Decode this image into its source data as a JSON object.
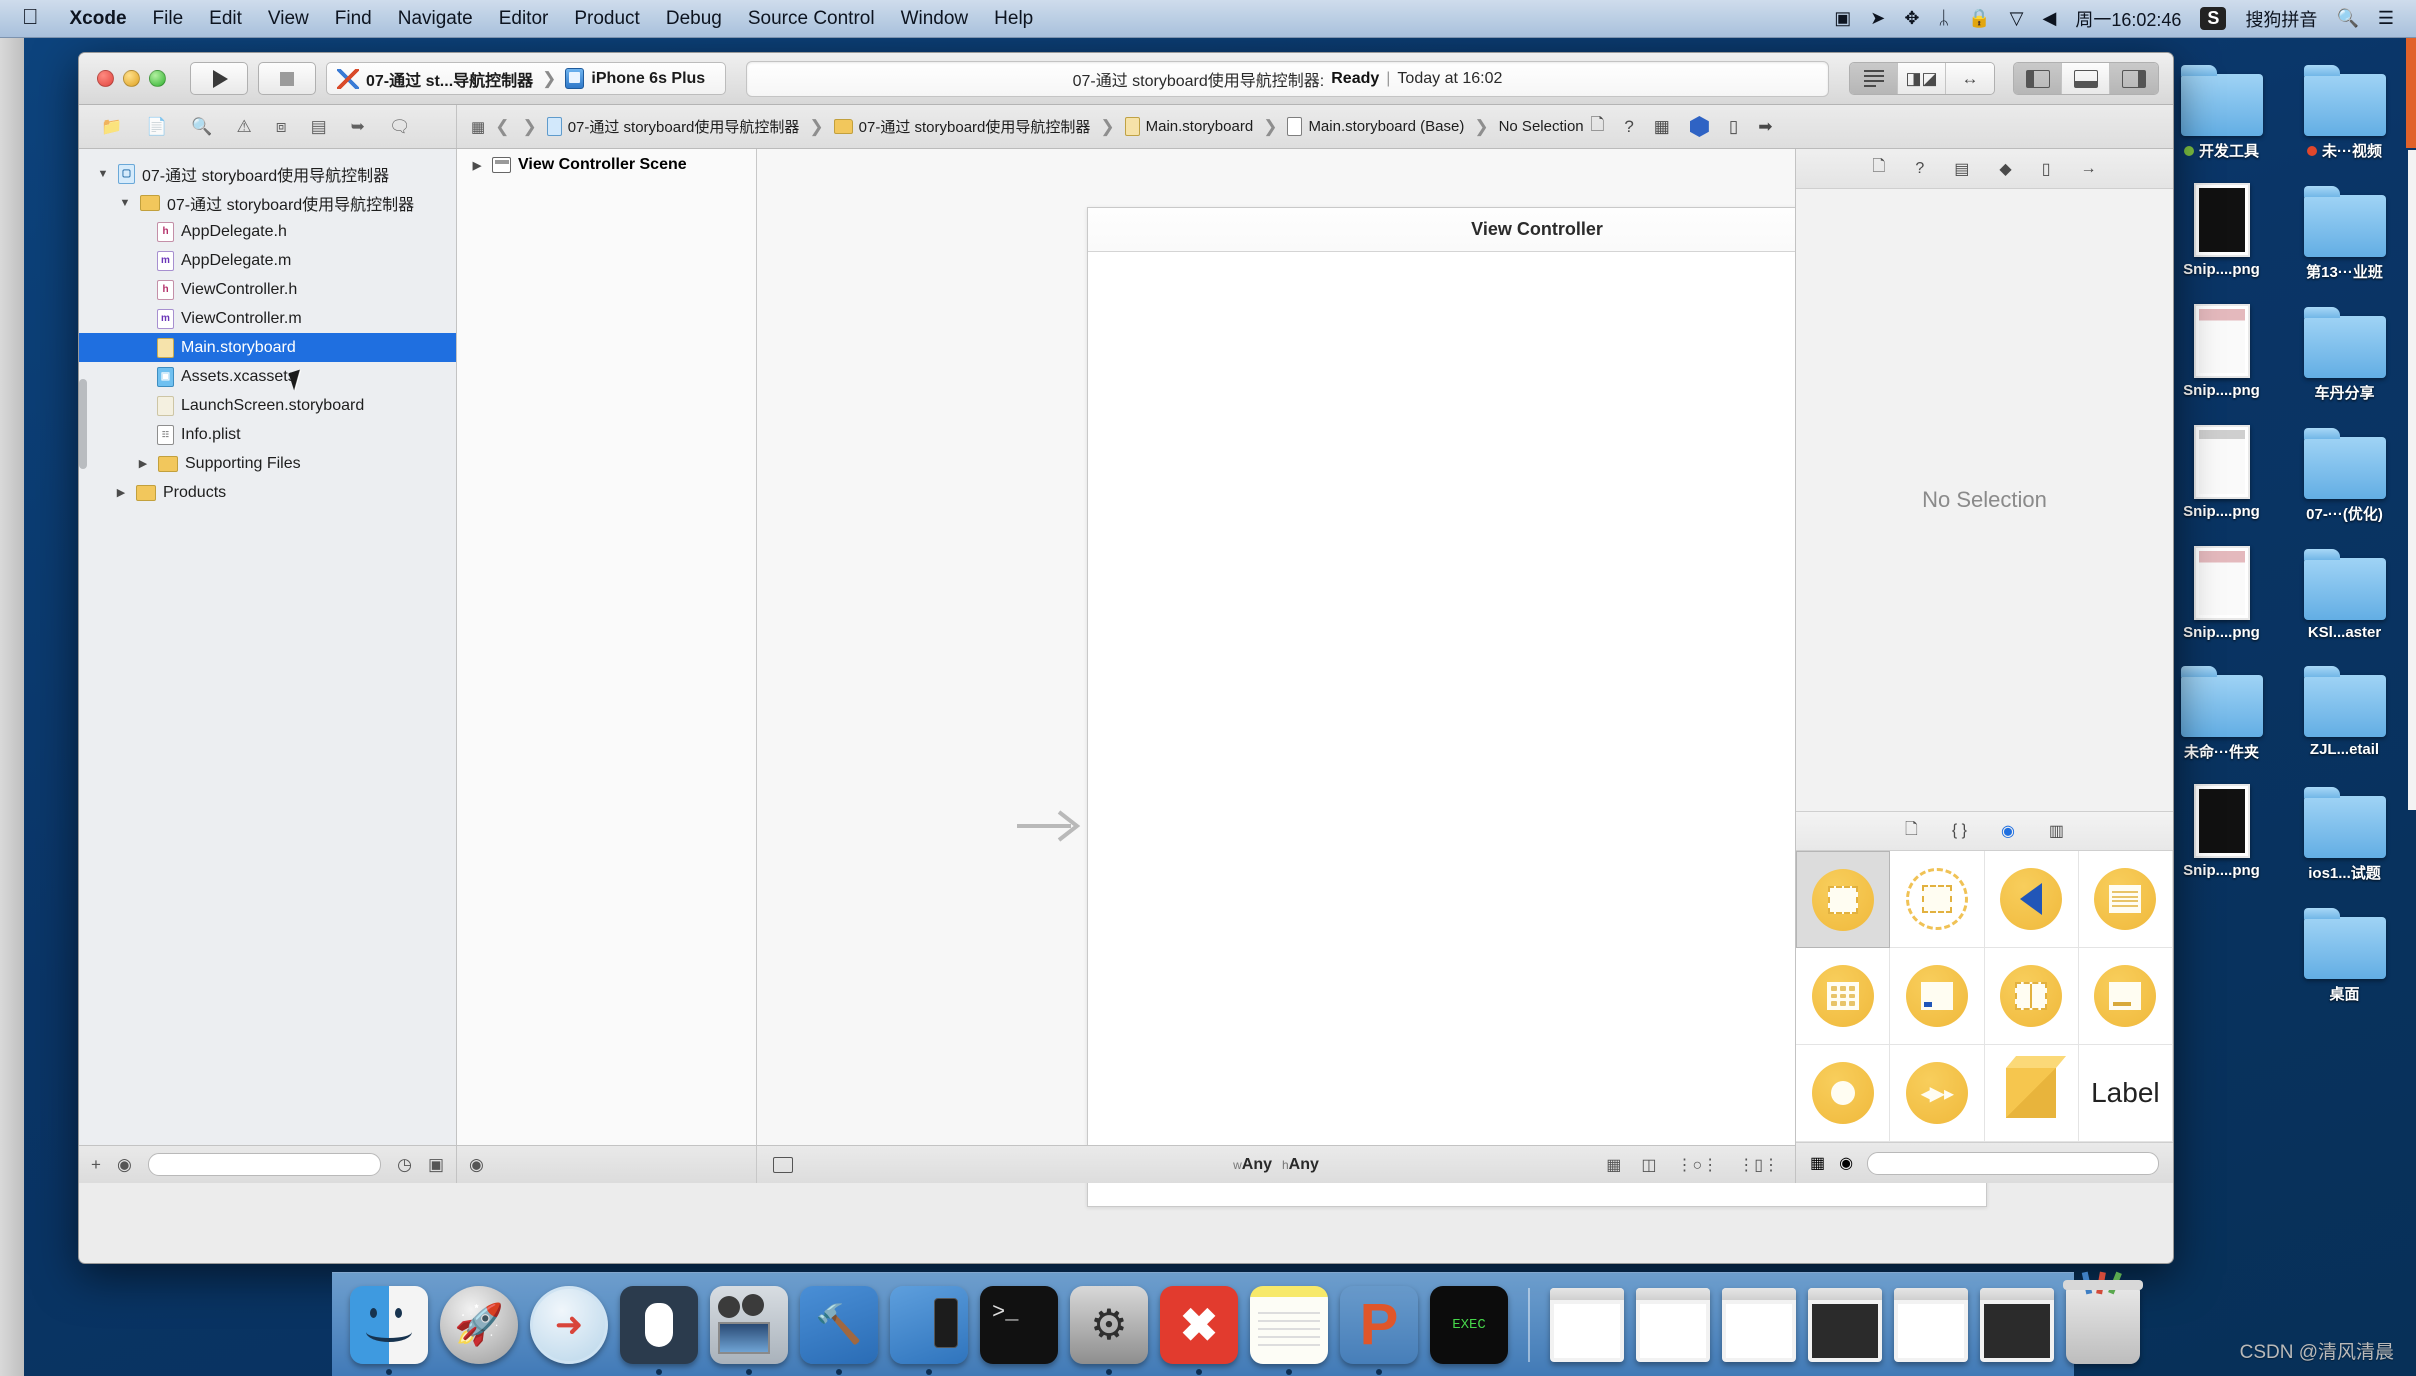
{
  "menubar": {
    "apple_icon": "apple-logo-icon",
    "items": [
      {
        "label": "Xcode",
        "bold": true
      },
      {
        "label": "File",
        "bold": false
      },
      {
        "label": "Edit",
        "bold": false
      },
      {
        "label": "View",
        "bold": false
      },
      {
        "label": "Find",
        "bold": false
      },
      {
        "label": "Navigate",
        "bold": false
      },
      {
        "label": "Editor",
        "bold": false
      },
      {
        "label": "Product",
        "bold": false
      },
      {
        "label": "Debug",
        "bold": false
      },
      {
        "label": "Source Control",
        "bold": false
      },
      {
        "label": "Window",
        "bold": false
      },
      {
        "label": "Help",
        "bold": false
      }
    ],
    "status_items": [
      {
        "name": "screen-record-icon",
        "glyph": "▣"
      },
      {
        "name": "location-arrow-icon",
        "glyph": "➤"
      },
      {
        "name": "airplay-icon",
        "glyph": "✥"
      },
      {
        "name": "bluetooth-icon",
        "glyph": "ᛦ"
      },
      {
        "name": "lock-icon",
        "glyph": "🔒"
      },
      {
        "name": "wifi-icon",
        "glyph": "▽"
      },
      {
        "name": "volume-icon",
        "glyph": "◀"
      }
    ],
    "clock": "周一16:02:46",
    "input_badge": "S",
    "input_method": "搜狗拼音",
    "search_icon": "search-icon",
    "list_icon": "notification-center-icon"
  },
  "toolbar": {
    "run_button": "run-button",
    "stop_button": "stop-button",
    "scheme_name": "07-通过 st...导航控制器",
    "destination": "iPhone 6s Plus",
    "status_project": "07-通过 storyboard使用导航控制器:",
    "status_state": "Ready",
    "status_separator": "|",
    "status_time": "Today at 16:02"
  },
  "jumpbar": {
    "crumbs": [
      {
        "label": "07-通过 storyboard使用导航控制器",
        "icon": "project-icon"
      },
      {
        "label": "07-通过 storyboard使用导航控制器",
        "icon": "folder-icon"
      },
      {
        "label": "Main.storyboard",
        "icon": "storyboard-icon"
      },
      {
        "label": "Main.storyboard (Base)",
        "icon": "document-icon"
      },
      {
        "label": "No Selection",
        "icon": ""
      }
    ]
  },
  "navigator": {
    "items": [
      {
        "label": "07-通过 storyboard使用导航控制器",
        "kind": "project",
        "depth": 0,
        "twisty": "▼",
        "selected": false
      },
      {
        "label": "07-通过 storyboard使用导航控制器",
        "kind": "folder",
        "depth": 1,
        "twisty": "▼",
        "selected": false
      },
      {
        "label": "AppDelegate.h",
        "kind": "h",
        "depth": 2,
        "twisty": "",
        "selected": false
      },
      {
        "label": "AppDelegate.m",
        "kind": "m",
        "depth": 2,
        "twisty": "",
        "selected": false
      },
      {
        "label": "ViewController.h",
        "kind": "h",
        "depth": 2,
        "twisty": "",
        "selected": false
      },
      {
        "label": "ViewController.m",
        "kind": "m",
        "depth": 2,
        "twisty": "",
        "selected": false
      },
      {
        "label": "Main.storyboard",
        "kind": "storyboard",
        "depth": 2,
        "twisty": "",
        "selected": true
      },
      {
        "label": "Assets.xcassets",
        "kind": "assets",
        "depth": 2,
        "twisty": "",
        "selected": false
      },
      {
        "label": "LaunchScreen.storyboard",
        "kind": "storyboard2",
        "depth": 2,
        "twisty": "",
        "selected": false
      },
      {
        "label": "Info.plist",
        "kind": "plist",
        "depth": 2,
        "twisty": "",
        "selected": false
      },
      {
        "label": "Supporting Files",
        "kind": "folder",
        "depth": 2,
        "twisty": "▶",
        "selected": false
      },
      {
        "label": "Products",
        "kind": "folder",
        "depth": 1,
        "twisty": "▶",
        "selected": false
      }
    ],
    "footer": {
      "add_icon": "add-button",
      "filter_icon": "filter-circle-icon",
      "clock_icon": "recent-filter-icon",
      "source_icon": "source-control-filter-icon",
      "filter_placeholder": ""
    }
  },
  "outline": {
    "scene_label": "View Controller Scene",
    "twisty": "▶",
    "footer_icon": "filter-circle-icon"
  },
  "canvas": {
    "scene_title": "View Controller",
    "entry_arrow": "initial-view-controller-arrow",
    "battery": "status-bar-battery-icon",
    "footer": {
      "panel_icon": "document-outline-toggle",
      "size_w_prefix": "w",
      "size_w_value": "Any",
      "size_h_prefix": "h",
      "size_h_value": "Any",
      "right_icons": [
        "constraints-icon",
        "align-icon",
        "resolve-issues-icon",
        "embed-in-icon"
      ]
    }
  },
  "utilities": {
    "inspector_tabs": [
      {
        "name": "file-inspector-tab",
        "glyph": "🗋"
      },
      {
        "name": "quick-help-inspector-tab",
        "glyph": "?"
      },
      {
        "name": "identity-inspector-tab",
        "glyph": "▤"
      },
      {
        "name": "attributes-inspector-tab",
        "glyph": "◆"
      },
      {
        "name": "size-inspector-tab",
        "glyph": "▯"
      },
      {
        "name": "connections-inspector-tab",
        "glyph": "→"
      }
    ],
    "no_selection": "No Selection",
    "library_tabs": [
      {
        "name": "file-template-library-tab",
        "glyph": "🗋",
        "active": false
      },
      {
        "name": "code-snippet-library-tab",
        "glyph": "{ }",
        "active": false
      },
      {
        "name": "object-library-tab",
        "glyph": "◉",
        "active": true
      },
      {
        "name": "media-library-tab",
        "glyph": "▥",
        "active": false
      }
    ],
    "library_items": [
      {
        "name": "view-controller-object",
        "shape": "view-controller",
        "selected": true
      },
      {
        "name": "storyboard-reference-object",
        "shape": "storyboard-ref",
        "selected": false
      },
      {
        "name": "navigation-controller-object",
        "shape": "nav-controller",
        "selected": false
      },
      {
        "name": "table-view-controller-object",
        "shape": "table-controller",
        "selected": false
      },
      {
        "name": "collection-view-controller-object",
        "shape": "collection-controller",
        "selected": false
      },
      {
        "name": "tab-bar-controller-object",
        "shape": "tabbar-controller",
        "selected": false
      },
      {
        "name": "split-view-controller-object",
        "shape": "split-controller",
        "selected": false
      },
      {
        "name": "page-view-controller-object",
        "shape": "page-controller",
        "selected": false
      },
      {
        "name": "gl-kit-view-controller-object",
        "shape": "glkit-controller",
        "selected": false
      },
      {
        "name": "avkit-player-view-controller-object",
        "shape": "avkit-controller",
        "selected": false
      },
      {
        "name": "object-cube",
        "shape": "cube",
        "selected": false
      },
      {
        "name": "label-object",
        "shape": "label",
        "label": "Label",
        "selected": false
      }
    ],
    "library_footer": {
      "grid_icon": "library-grid-view-icon",
      "filter_icon": "filter-circle-icon",
      "search_placeholder": ""
    }
  },
  "desktop": {
    "icons": [
      {
        "label": "开发工具",
        "kind": "folder",
        "tag": "green"
      },
      {
        "label": "未···视频",
        "kind": "folder",
        "tag": "red"
      },
      {
        "label": "Snip....png",
        "kind": "png-dark",
        "tag": ""
      },
      {
        "label": "第13···业班",
        "kind": "folder",
        "tag": ""
      },
      {
        "label": "Snip....png",
        "kind": "png-light",
        "tag": ""
      },
      {
        "label": "车丹分享",
        "kind": "folder",
        "tag": ""
      },
      {
        "label": "Snip....png",
        "kind": "png-light2",
        "tag": ""
      },
      {
        "label": "07-···(优化)",
        "kind": "folder",
        "tag": ""
      },
      {
        "label": "Snip....png",
        "kind": "png-light",
        "tag": ""
      },
      {
        "label": "KSl...aster",
        "kind": "folder",
        "tag": ""
      },
      {
        "label": "未命···件夹",
        "kind": "folder",
        "tag": ""
      },
      {
        "label": "ZJL...etail",
        "kind": "folder",
        "tag": ""
      },
      {
        "label": "Snip....png",
        "kind": "png-dark",
        "tag": ""
      },
      {
        "label": "ios1...试题",
        "kind": "folder",
        "tag": ""
      },
      {
        "label": "",
        "kind": "none",
        "tag": ""
      },
      {
        "label": "桌面",
        "kind": "folder",
        "tag": ""
      }
    ]
  },
  "dock": {
    "apps": [
      {
        "name": "finder-dock-icon",
        "running": true
      },
      {
        "name": "launchpad-dock-icon",
        "running": false
      },
      {
        "name": "safari-dock-icon",
        "running": false
      },
      {
        "name": "mouse-app-dock-icon",
        "running": true
      },
      {
        "name": "imovie-dock-icon",
        "running": true
      },
      {
        "name": "xcode-dock-icon",
        "running": true
      },
      {
        "name": "simulator-dock-icon",
        "running": true
      },
      {
        "name": "terminal-dock-icon",
        "running": false
      },
      {
        "name": "system-preferences-dock-icon",
        "running": true
      },
      {
        "name": "xmind-dock-icon",
        "running": true
      },
      {
        "name": "notes-dock-icon",
        "running": true
      },
      {
        "name": "powerpoint-dock-icon",
        "running": true
      },
      {
        "name": "exec-app-dock-icon",
        "running": false
      }
    ],
    "minimized": [
      {
        "name": "minimized-window-1"
      },
      {
        "name": "minimized-window-2"
      },
      {
        "name": "minimized-window-3"
      },
      {
        "name": "minimized-window-4"
      },
      {
        "name": "minimized-window-5"
      },
      {
        "name": "minimized-window-6"
      }
    ],
    "trash": "trash-dock-icon"
  },
  "watermark": "CSDN @清风清晨"
}
